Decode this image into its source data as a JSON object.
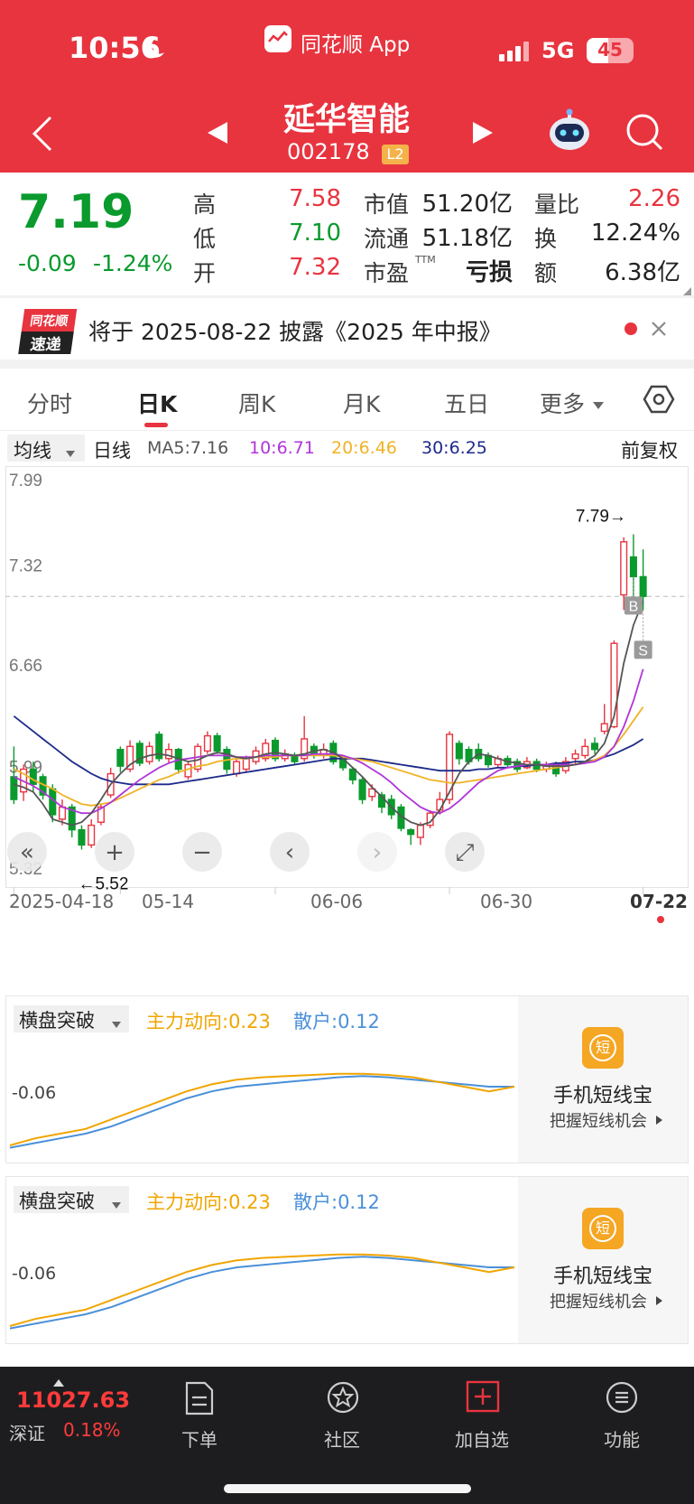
{
  "status_bar": {
    "time": "10:56",
    "app": "同花顺 App",
    "network": "5G",
    "battery": "45"
  },
  "header": {
    "name": "延华智能",
    "code": "002178",
    "badge": "L2"
  },
  "quote": {
    "price": "7.19",
    "change": "-0.09",
    "change_pct": "-1.24%",
    "high_label": "高",
    "high": "7.58",
    "low_label": "低",
    "low": "7.10",
    "open_label": "开",
    "open": "7.32",
    "mcap_label": "市值",
    "mcap": "51.20亿",
    "float_label": "流通",
    "float": "51.18亿",
    "pe_label": "市盈",
    "pe_sup": "TTM",
    "pe": "亏损",
    "vr_label": "量比",
    "vr": "2.26",
    "turn_label": "换",
    "turn": "12.24%",
    "amt_label": "额",
    "amt": "6.38亿"
  },
  "notice": {
    "logo_top": "同花顺",
    "logo_bottom": "速递",
    "text": "将于 2025-08-22 披露《2025 年中报》"
  },
  "tabs": [
    {
      "label": "分时"
    },
    {
      "label": "日K",
      "active": true
    },
    {
      "label": "周K"
    },
    {
      "label": "月K"
    },
    {
      "label": "五日"
    },
    {
      "label": "更多"
    }
  ],
  "ma_bar": {
    "selector": "均线",
    "period": "日线",
    "ma5": "MA5:7.16",
    "ma10": "10:6.71",
    "ma20": "20:6.46",
    "ma30": "30:6.25",
    "adjust": "前复权",
    "colors": {
      "ma5": "#555555",
      "ma10": "#b035d9",
      "ma20": "#f0b325",
      "ma30": "#1d2a8a"
    }
  },
  "chart_data": {
    "type": "candlestick",
    "y_ticks": [
      "7.99",
      "7.32",
      "6.66",
      "5.99",
      "5.32"
    ],
    "ylim": [
      5.32,
      7.99
    ],
    "x_ticks": [
      "2025-04-18",
      "05-14",
      "06-06",
      "06-30",
      "07-22"
    ],
    "current_line": 7.19,
    "max_annotation": "7.79→",
    "min_annotation": "←5.52",
    "markers": [
      "B",
      "S"
    ],
    "colors": {
      "up": "#e8343f",
      "down": "#0a9a2d"
    },
    "candles": [
      [
        6.0,
        5.85,
        6.2,
        5.82
      ],
      [
        5.9,
        6.05,
        6.08,
        5.84
      ],
      [
        6.05,
        5.95,
        6.1,
        5.9
      ],
      [
        6.0,
        5.88,
        6.02,
        5.85
      ],
      [
        5.92,
        5.75,
        5.95,
        5.7
      ],
      [
        5.72,
        5.8,
        5.85,
        5.68
      ],
      [
        5.8,
        5.65,
        5.82,
        5.6
      ],
      [
        5.65,
        5.55,
        5.68,
        5.52
      ],
      [
        5.55,
        5.68,
        5.72,
        5.53
      ],
      [
        5.7,
        5.8,
        5.82,
        5.68
      ],
      [
        5.88,
        6.02,
        6.06,
        5.86
      ],
      [
        6.18,
        6.07,
        6.2,
        6.03
      ],
      [
        6.05,
        6.2,
        6.24,
        6.03
      ],
      [
        6.22,
        6.09,
        6.24,
        6.07
      ],
      [
        6.1,
        6.2,
        6.23,
        6.08
      ],
      [
        6.28,
        6.12,
        6.3,
        6.1
      ],
      [
        6.12,
        6.18,
        6.22,
        6.09
      ],
      [
        6.18,
        6.05,
        6.19,
        6.02
      ],
      [
        6.0,
        6.08,
        6.1,
        5.98
      ],
      [
        6.05,
        6.2,
        6.22,
        6.03
      ],
      [
        6.17,
        6.27,
        6.3,
        6.15
      ],
      [
        6.27,
        6.17,
        6.29,
        6.15
      ],
      [
        6.18,
        6.05,
        6.2,
        6.02
      ],
      [
        6.02,
        6.1,
        6.12,
        6.0
      ],
      [
        6.05,
        6.12,
        6.14,
        6.03
      ],
      [
        6.1,
        6.17,
        6.2,
        6.08
      ],
      [
        6.12,
        6.22,
        6.25,
        6.1
      ],
      [
        6.24,
        6.12,
        6.26,
        6.1
      ],
      [
        6.12,
        6.15,
        6.18,
        6.1
      ],
      [
        6.14,
        6.1,
        6.16,
        6.08
      ],
      [
        6.12,
        6.25,
        6.4,
        6.1
      ],
      [
        6.2,
        6.15,
        6.22,
        6.12
      ],
      [
        6.15,
        6.18,
        6.22,
        6.12
      ],
      [
        6.22,
        6.1,
        6.24,
        6.08
      ],
      [
        6.12,
        6.06,
        6.14,
        6.04
      ],
      [
        6.05,
        5.98,
        6.06,
        5.95
      ],
      [
        5.98,
        5.85,
        6.0,
        5.82
      ],
      [
        5.87,
        5.92,
        5.95,
        5.84
      ],
      [
        5.88,
        5.8,
        5.9,
        5.76
      ],
      [
        5.85,
        5.75,
        5.88,
        5.72
      ],
      [
        5.8,
        5.66,
        5.82,
        5.64
      ],
      [
        5.65,
        5.62,
        5.66,
        5.55
      ],
      [
        5.6,
        5.68,
        5.7,
        5.55
      ],
      [
        5.68,
        5.76,
        5.78,
        5.66
      ],
      [
        5.78,
        5.85,
        5.9,
        5.75
      ],
      [
        5.85,
        6.28,
        6.3,
        5.82
      ],
      [
        6.22,
        6.12,
        6.24,
        6.08
      ],
      [
        6.18,
        6.1,
        6.2,
        6.08
      ],
      [
        6.18,
        6.12,
        6.22,
        6.1
      ],
      [
        6.14,
        6.08,
        6.16,
        6.06
      ],
      [
        6.08,
        6.12,
        6.14,
        6.06
      ],
      [
        6.12,
        6.08,
        6.14,
        6.06
      ],
      [
        6.1,
        6.05,
        6.12,
        6.03
      ],
      [
        6.06,
        6.1,
        6.13,
        6.05
      ],
      [
        6.1,
        6.05,
        6.12,
        6.03
      ],
      [
        6.05,
        6.08,
        6.1,
        6.03
      ],
      [
        6.08,
        6.02,
        6.1,
        6.0
      ],
      [
        6.04,
        6.1,
        6.13,
        6.02
      ],
      [
        6.12,
        6.15,
        6.18,
        6.08
      ],
      [
        6.14,
        6.2,
        6.25,
        6.12
      ],
      [
        6.22,
        6.18,
        6.26,
        6.15
      ],
      [
        6.3,
        6.35,
        6.48,
        6.28
      ],
      [
        6.33,
        6.88,
        6.9,
        6.32
      ],
      [
        7.2,
        7.55,
        7.58,
        7.1
      ],
      [
        7.45,
        7.32,
        7.6,
        7.18
      ],
      [
        7.32,
        7.19,
        7.5,
        7.1
      ]
    ],
    "ma5": [
      5.95,
      5.93,
      5.9,
      5.82,
      5.72,
      5.7,
      5.68,
      5.7,
      5.76,
      5.85,
      5.95,
      6.02,
      6.08,
      6.12,
      6.14,
      6.15,
      6.14,
      6.12,
      6.1,
      6.11,
      6.14,
      6.16,
      6.15,
      6.13,
      6.12,
      6.13,
      6.15,
      6.16,
      6.15,
      6.14,
      6.15,
      6.17,
      6.18,
      6.16,
      6.12,
      6.06,
      6.0,
      5.93,
      5.87,
      5.8,
      5.74,
      5.7,
      5.68,
      5.7,
      5.78,
      5.9,
      6.02,
      6.1,
      6.15,
      6.14,
      6.12,
      6.1,
      6.09,
      6.08,
      6.08,
      6.07,
      6.07,
      6.07,
      6.08,
      6.1,
      6.14,
      6.22,
      6.4,
      6.75,
      7.0,
      7.16
    ],
    "ma10": [
      6.0,
      5.97,
      5.94,
      5.9,
      5.85,
      5.8,
      5.78,
      5.76,
      5.76,
      5.79,
      5.83,
      5.88,
      5.93,
      5.98,
      6.02,
      6.06,
      6.09,
      6.11,
      6.12,
      6.13,
      6.14,
      6.14,
      6.14,
      6.13,
      6.13,
      6.13,
      6.14,
      6.14,
      6.14,
      6.14,
      6.14,
      6.15,
      6.15,
      6.15,
      6.14,
      6.12,
      6.09,
      6.05,
      6.01,
      5.96,
      5.9,
      5.85,
      5.8,
      5.77,
      5.76,
      5.79,
      5.84,
      5.9,
      5.96,
      6.0,
      6.04,
      6.06,
      6.07,
      6.08,
      6.08,
      6.08,
      6.08,
      6.08,
      6.08,
      6.09,
      6.1,
      6.13,
      6.2,
      6.33,
      6.5,
      6.71
    ],
    "ma20": [
      6.05,
      6.02,
      5.98,
      5.95,
      5.92,
      5.88,
      5.85,
      5.82,
      5.81,
      5.82,
      5.83,
      5.86,
      5.89,
      5.92,
      5.95,
      5.98,
      6.0,
      6.03,
      6.05,
      6.07,
      6.08,
      6.1,
      6.11,
      6.12,
      6.12,
      6.13,
      6.13,
      6.13,
      6.14,
      6.14,
      6.14,
      6.14,
      6.14,
      6.14,
      6.13,
      6.12,
      6.11,
      6.1,
      6.08,
      6.06,
      6.04,
      6.02,
      6.0,
      5.98,
      5.97,
      5.96,
      5.96,
      5.97,
      5.98,
      5.99,
      6.0,
      6.01,
      6.02,
      6.03,
      6.04,
      6.05,
      6.06,
      6.07,
      6.08,
      6.09,
      6.11,
      6.14,
      6.2,
      6.28,
      6.37,
      6.46
    ],
    "ma30": [
      6.4,
      6.35,
      6.3,
      6.25,
      6.2,
      6.15,
      6.1,
      6.06,
      6.02,
      5.99,
      5.97,
      5.96,
      5.95,
      5.95,
      5.95,
      5.95,
      5.95,
      5.96,
      5.97,
      5.98,
      5.99,
      6.0,
      6.01,
      6.02,
      6.03,
      6.04,
      6.05,
      6.06,
      6.07,
      6.08,
      6.09,
      6.1,
      6.11,
      6.12,
      6.12,
      6.12,
      6.12,
      6.11,
      6.1,
      6.09,
      6.08,
      6.07,
      6.06,
      6.05,
      6.04,
      6.04,
      6.04,
      6.04,
      6.05,
      6.05,
      6.06,
      6.06,
      6.07,
      6.07,
      6.08,
      6.08,
      6.09,
      6.09,
      6.1,
      6.1,
      6.11,
      6.13,
      6.15,
      6.18,
      6.21,
      6.25
    ]
  },
  "indicator": {
    "name": "横盘突破",
    "main": "主力动向:0.23",
    "retail": "散户:0.12",
    "level": "-0.06",
    "colors": {
      "main": "#f0a500",
      "retail": "#4a90d9"
    },
    "main_values": [
      0.05,
      0.08,
      0.1,
      0.12,
      0.16,
      0.2,
      0.24,
      0.28,
      0.31,
      0.33,
      0.34,
      0.345,
      0.35,
      0.355,
      0.355,
      0.35,
      0.34,
      0.32,
      0.3,
      0.28,
      0.3
    ],
    "retail_values": [
      0.04,
      0.06,
      0.08,
      0.1,
      0.13,
      0.17,
      0.21,
      0.25,
      0.28,
      0.3,
      0.31,
      0.32,
      0.33,
      0.34,
      0.345,
      0.34,
      0.33,
      0.32,
      0.31,
      0.3,
      0.3
    ]
  },
  "promo": {
    "title": "手机短线宝",
    "subtitle": "把握短线机会",
    "icon_char": "短"
  },
  "bottom": {
    "index_value": "11027.63",
    "index_name": "深证",
    "index_pct": "0.18%",
    "nav": [
      {
        "label": "下单"
      },
      {
        "label": "社区"
      },
      {
        "label": "加自选"
      },
      {
        "label": "功能"
      }
    ]
  }
}
